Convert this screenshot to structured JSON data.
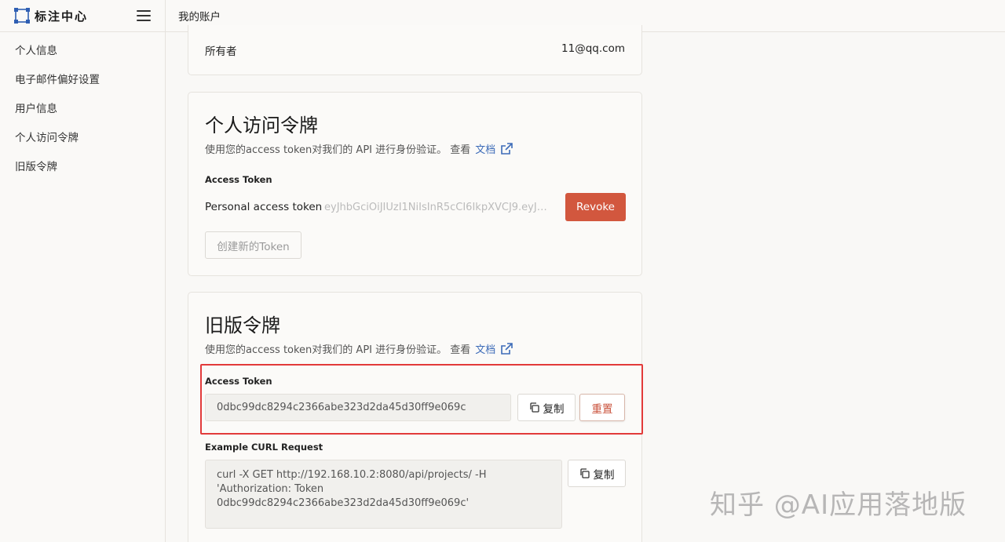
{
  "app": {
    "brand": "标注中心"
  },
  "topbar": {
    "title": "我的账户"
  },
  "sidebar": {
    "items": [
      {
        "label": "个人信息"
      },
      {
        "label": "电子邮件偏好设置"
      },
      {
        "label": "用户信息"
      },
      {
        "label": "个人访问令牌"
      },
      {
        "label": "旧版令牌"
      }
    ]
  },
  "owner": {
    "label": "所有者",
    "value": "11@qq.com"
  },
  "personal_tokens": {
    "title": "个人访问令牌",
    "description": "使用您的access token对我们的 API 进行身份验证。 查看",
    "doc_link": "文档",
    "section_label": "Access Token",
    "token_name": "Personal access token",
    "token_value": "eyJhbGciOiJIUzI1NiIsInR5cCI6IkpXVCJ9.eyJ…",
    "revoke_label": "Revoke",
    "create_label": "创建新的Token"
  },
  "legacy_tokens": {
    "title": "旧版令牌",
    "description": "使用您的access token对我们的 API 进行身份验证。 查看",
    "doc_link": "文档",
    "section_label": "Access Token",
    "token_value": "0dbc99dc8294c2366abe323d2da45d30ff9e069c",
    "copy_label": "复制",
    "reset_label": "重置",
    "curl_label": "Example CURL Request",
    "curl_lines": [
      "curl -X GET http://192.168.10.2:8080/api/projects/ -H",
      "'Authorization: Token",
      "0dbc99dc8294c2366abe323d2da45d30ff9e069c'"
    ],
    "curl_copy_label": "复制"
  },
  "watermark": "知乎 @AI应用落地版",
  "colors": {
    "accent": "#d2573e",
    "link": "#3c6bb8",
    "highlight": "#e23a3a"
  }
}
